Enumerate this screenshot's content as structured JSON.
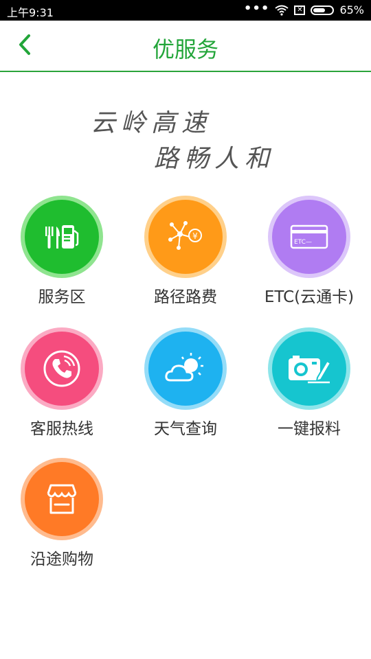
{
  "status": {
    "time": "上午9:31",
    "battery": "65%",
    "battery_level": 0.65,
    "icons": [
      "dots-icon",
      "wifi-icon",
      "sim-x-icon",
      "battery-icon"
    ]
  },
  "header": {
    "title": "优服务",
    "back_icon": "chevron-left-icon",
    "accent": "#22a539"
  },
  "slogan": {
    "line1": "云岭高速",
    "line2": "路畅人和"
  },
  "services": [
    {
      "label": "服务区",
      "icon": "restaurant-fuel-icon",
      "color": "#1fbd2f",
      "ring": "#8fe48f"
    },
    {
      "label": "路径路费",
      "icon": "route-fee-icon",
      "color": "#ff9a18",
      "ring": "#ffd08a"
    },
    {
      "label": "ETC(云通卡)",
      "icon": "etc-card-icon",
      "color": "#b07cf2",
      "ring": "#dcc6fa"
    },
    {
      "label": "客服热线",
      "icon": "phone-call-icon",
      "color": "#f54d7e",
      "ring": "#fbaac3"
    },
    {
      "label": "天气查询",
      "icon": "weather-icon",
      "color": "#1eb2f0",
      "ring": "#94dcf8"
    },
    {
      "label": "一键报料",
      "icon": "camera-edit-icon",
      "color": "#16c5cf",
      "ring": "#8ee5ea"
    },
    {
      "label": "沿途购物",
      "icon": "shop-icon",
      "color": "#ff7a26",
      "ring": "#ffbb8e"
    }
  ]
}
